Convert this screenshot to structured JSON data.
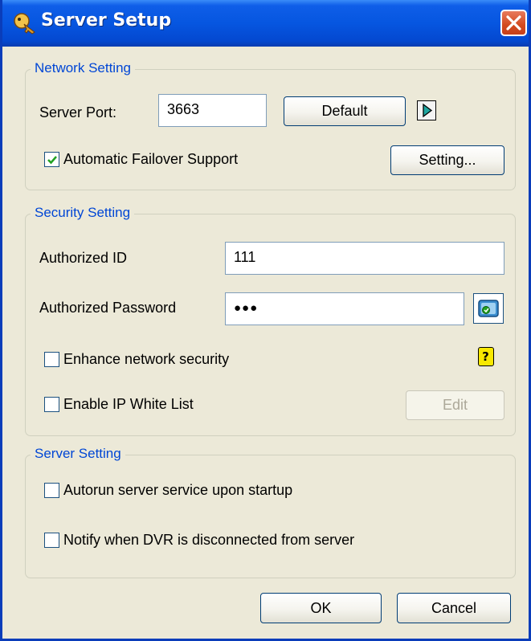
{
  "window": {
    "title": "Server Setup"
  },
  "network": {
    "legend": "Network Setting",
    "port_label": "Server Port:",
    "port_value": "3663",
    "default_button": "Default",
    "failover_checked": true,
    "failover_label": "Automatic Failover Support",
    "setting_button": "Setting..."
  },
  "security": {
    "legend": "Security Setting",
    "id_label": "Authorized ID",
    "id_value": "111",
    "password_label": "Authorized Password",
    "password_value": "●●●",
    "enhance_checked": false,
    "enhance_label": "Enhance network security",
    "whitelist_checked": false,
    "whitelist_label": "Enable IP White List",
    "edit_button": "Edit"
  },
  "server": {
    "legend": "Server Setting",
    "autorun_checked": false,
    "autorun_label": "Autorun server service upon startup",
    "notify_checked": false,
    "notify_label": "Notify when DVR is disconnected from server"
  },
  "footer": {
    "ok_button": "OK",
    "cancel_button": "Cancel"
  },
  "colors": {
    "title_blue": "#0656e0",
    "legend_blue": "#0046d5",
    "close_red": "#d24a1f",
    "check_green": "#21a121"
  }
}
